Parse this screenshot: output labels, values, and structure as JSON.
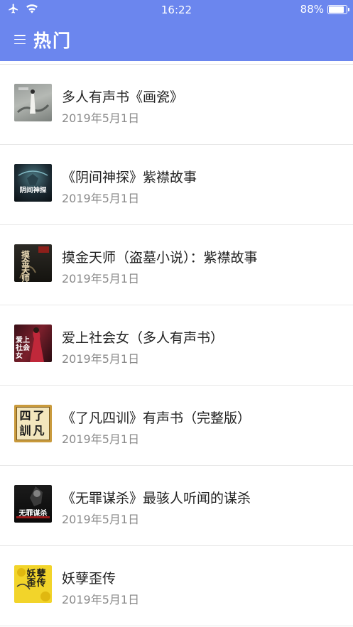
{
  "status_bar": {
    "time": "16:22",
    "battery": "88%",
    "battery_level": 0.88
  },
  "header": {
    "title": "热门",
    "background": "#6b86ee"
  },
  "items": [
    {
      "title": "多人有声书《画瓷》",
      "date": "2019年5月1日"
    },
    {
      "title": "《阴间神探》紫襟故事",
      "date": "2019年5月1日",
      "cover_text": "阴间神探"
    },
    {
      "title": "摸金天师（盗墓小说）：紫襟故事",
      "date": "2019年5月1日",
      "cover_text": "摸金天师"
    },
    {
      "title": "爱上社会女（多人有声书）",
      "date": "2019年5月1日",
      "cover_text": "爱上社会女"
    },
    {
      "title": "《了凡四训》有声书（完整版）",
      "date": "2019年5月1日",
      "cover_text": "四了訓凡"
    },
    {
      "title": "《无罪谋杀》最骇人听闻的谋杀",
      "date": "2019年5月1日",
      "cover_text": "无罪谋杀"
    },
    {
      "title": "妖孽歪传",
      "date": "2019年5月1日",
      "cover_text": "妖孽歪传"
    }
  ]
}
